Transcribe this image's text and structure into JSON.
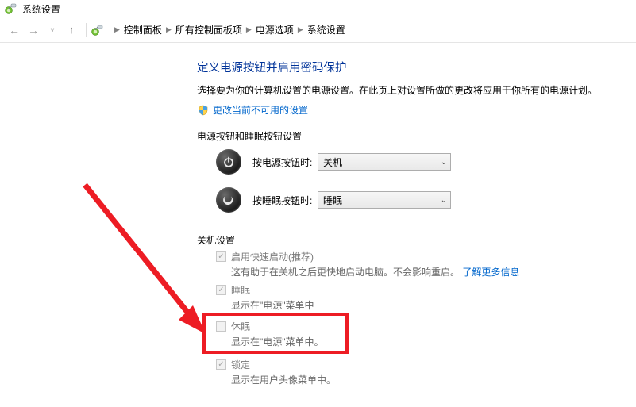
{
  "window": {
    "title": "系统设置"
  },
  "breadcrumb": {
    "items": [
      "控制面板",
      "所有控制面板项",
      "电源选项",
      "系统设置"
    ]
  },
  "main": {
    "heading": "定义电源按钮并启用密码保护",
    "subtext": "选择要为你的计算机设置的电源设置。在此页上对设置所做的更改将应用于你所有的电源计划。",
    "change_unavailable": "更改当前不可用的设置",
    "section_buttons": {
      "legend": "电源按钮和睡眠按钮设置",
      "power_button": {
        "label": "按电源按钮时:",
        "value": "关机"
      },
      "sleep_button": {
        "label": "按睡眠按钮时:",
        "value": "睡眠"
      }
    },
    "section_shutdown": {
      "legend": "关机设置",
      "fast_startup": {
        "label": "启用快速启动(推荐)",
        "desc_prefix": "这有助于在关机之后更快地启动电脑。不会影响重启。",
        "learn_more": "了解更多信息"
      },
      "sleep": {
        "label": "睡眠",
        "desc": "显示在\"电源\"菜单中"
      },
      "hibernate": {
        "label": "休眠",
        "desc": "显示在\"电源\"菜单中。"
      },
      "lock": {
        "label": "锁定",
        "desc": "显示在用户头像菜单中。"
      }
    }
  }
}
